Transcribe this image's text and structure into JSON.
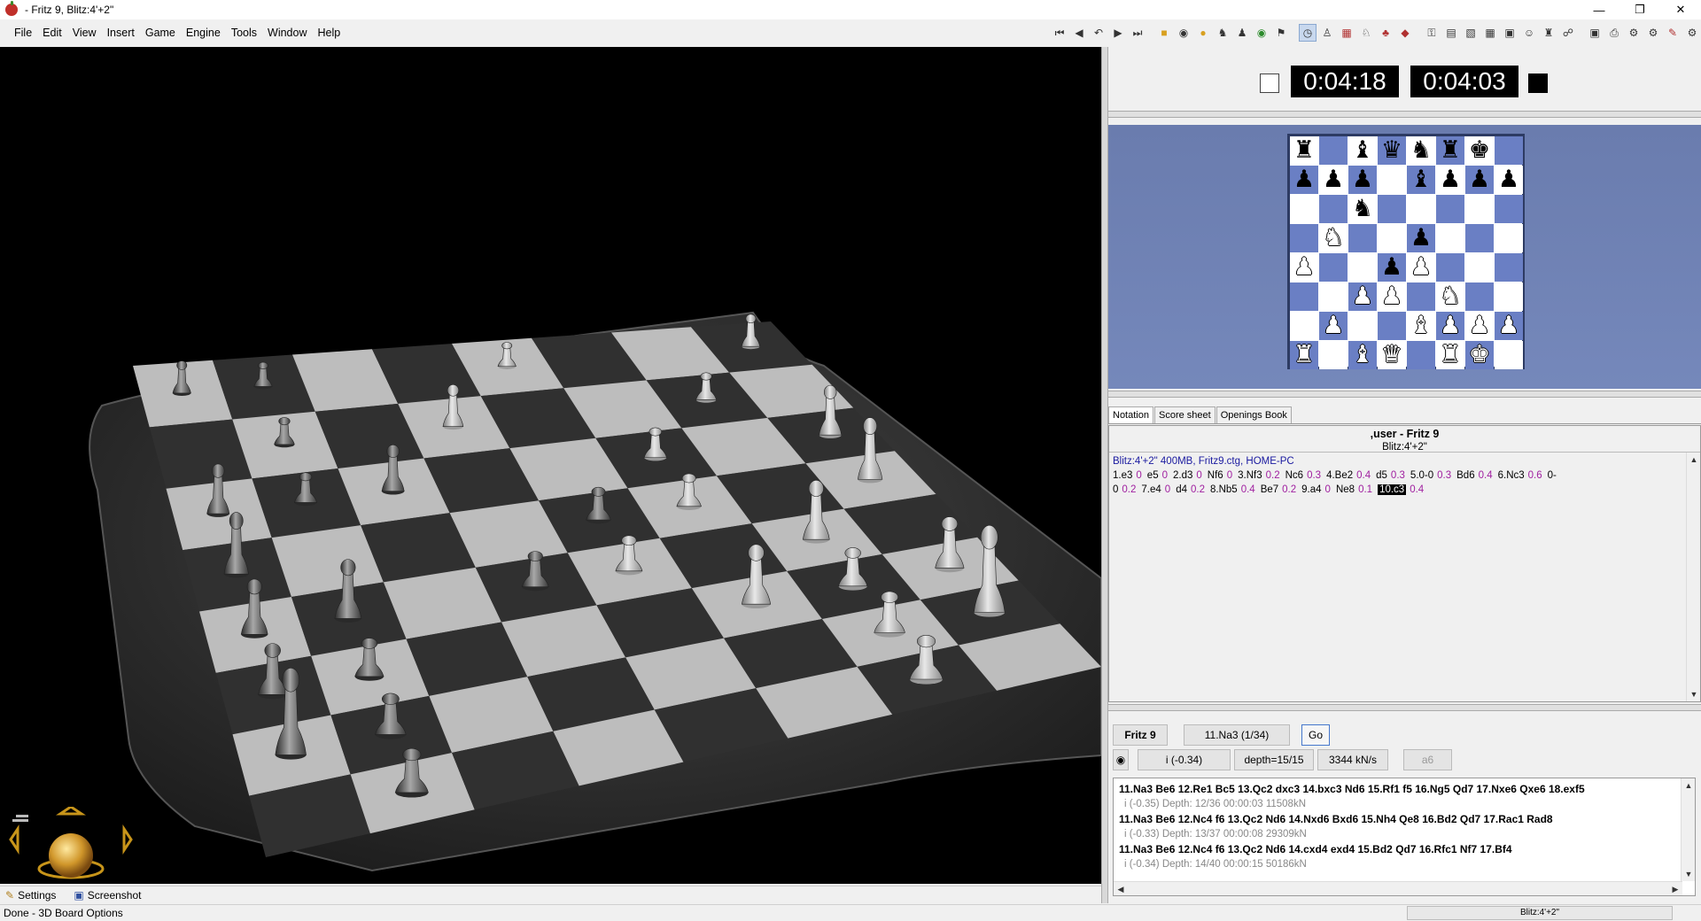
{
  "window": {
    "title": "- Fritz 9, Blitz:4'+2\"",
    "controls": [
      "minimize",
      "restore",
      "close"
    ]
  },
  "menu": [
    {
      "label": "File"
    },
    {
      "label": "Edit"
    },
    {
      "label": "View"
    },
    {
      "label": "Insert"
    },
    {
      "label": "Game"
    },
    {
      "label": "Engine"
    },
    {
      "label": "Tools"
    },
    {
      "label": "Window"
    },
    {
      "label": "Help"
    }
  ],
  "clock": {
    "white": "0:04:18",
    "black": "0:04:03"
  },
  "board2d": {
    "ranks": [
      [
        "r",
        "",
        "b",
        "q",
        "n",
        "r",
        "k",
        ""
      ],
      [
        "p",
        "p",
        "p",
        "",
        "b",
        "p",
        "p",
        "p"
      ],
      [
        "",
        "",
        "n",
        "",
        "",
        "",
        "",
        ""
      ],
      [
        "",
        "N",
        "",
        "",
        "p",
        "",
        "",
        ""
      ],
      [
        "P",
        "",
        "",
        "p",
        "P",
        "",
        "",
        ""
      ],
      [
        "",
        "",
        "P",
        "P",
        "",
        "N",
        "",
        ""
      ],
      [
        "",
        "P",
        "",
        "",
        "B",
        "P",
        "P",
        "P"
      ],
      [
        "R",
        "",
        "B",
        "Q",
        "",
        "R",
        "K",
        ""
      ]
    ]
  },
  "tabs": [
    {
      "label": "Notation"
    },
    {
      "label": "Score sheet"
    },
    {
      "label": "Openings Book"
    }
  ],
  "notation": {
    "players": ",user - Fritz 9",
    "event": "Blitz:4'+2\"",
    "info": "Blitz:4'+2\"  400MB, Fritz9.ctg, HOME-PC",
    "moves": [
      {
        "m": "1.e3",
        "e": "0"
      },
      {
        "m": "e5",
        "e": "0"
      },
      {
        "m": "2.d3",
        "e": "0"
      },
      {
        "m": "Nf6",
        "e": "0"
      },
      {
        "m": "3.Nf3",
        "e": "0.2"
      },
      {
        "m": "Nc6",
        "e": "0.3"
      },
      {
        "m": "4.Be2",
        "e": "0.4"
      },
      {
        "m": "d5",
        "e": "0.3"
      },
      {
        "m": "5.0-0",
        "e": "0.3"
      },
      {
        "m": "Bd6",
        "e": "0.4"
      },
      {
        "m": "6.Nc3",
        "e": "0.6"
      },
      {
        "m": "0-0",
        "e": "0.2"
      },
      {
        "m": "7.e4",
        "e": "0"
      },
      {
        "m": "d4",
        "e": "0.2"
      },
      {
        "m": "8.Nb5",
        "e": "0.4"
      },
      {
        "m": "Be7",
        "e": "0.2"
      },
      {
        "m": "9.a4",
        "e": "0"
      },
      {
        "m": "Ne8",
        "e": "0.1"
      },
      {
        "m": "10.c3",
        "e": "0.4",
        "current": true
      }
    ]
  },
  "engine": {
    "name": "Fritz 9",
    "move": "11.Na3 (1/34)",
    "go": "Go",
    "eval": "i  (-0.34)",
    "depth": "depth=15/15",
    "speed": "3344 kN/s",
    "hint": "a6",
    "lines": [
      {
        "pv": "11.Na3 Be6 12.Re1 Bc5 13.Qc2 dxc3 14.bxc3 Nd6 15.Rf1 f5 16.Ng5 Qd7 17.Nxe6 Qxe6 18.exf5",
        "info": "i  (-0.35)   Depth: 12/36   00:00:03  11508kN"
      },
      {
        "pv": "11.Na3 Be6 12.Nc4 f6 13.Qc2 Nd6 14.Nxd6 Bxd6 15.Nh4 Qe8 16.Bd2 Qd7 17.Rac1 Rad8",
        "info": "i  (-0.33)   Depth: 13/37   00:00:08  29309kN"
      },
      {
        "pv": "11.Na3 Be6 12.Nc4 f6 13.Qc2 Nd6 14.cxd4 exd4 15.Bd2 Qd7 16.Rfc1 Nf7 17.Bf4",
        "info": "i  (-0.34)   Depth: 14/40   00:00:15  50186kN"
      }
    ]
  },
  "bottom_left": {
    "settings": "Settings",
    "screenshot": "Screenshot"
  },
  "status": {
    "text": "Done - 3D Board Options",
    "mode": "Blitz:4'+2\""
  },
  "colors": {
    "board_light": "#ffffff",
    "board_dark": "#6a7fc4",
    "board_bg": "#7082b5",
    "clock_bg": "#000000",
    "eval": "#a020a0",
    "info": "#1a1aa0"
  }
}
